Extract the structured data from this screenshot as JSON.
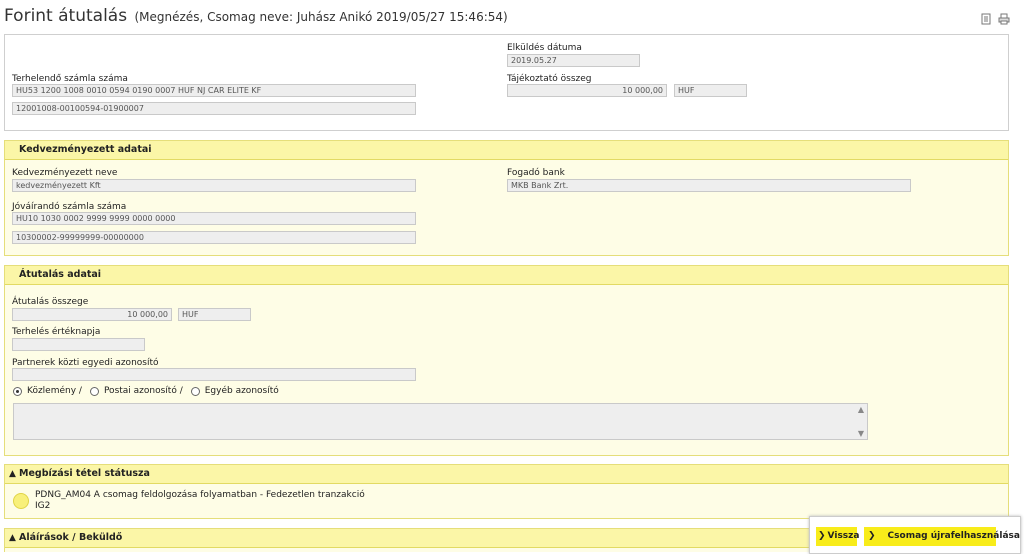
{
  "header": {
    "title": "Forint átutalás",
    "subtitle": "(Megnézés, Csomag neve: Juhász Anikó 2019/05/27 15:46:54)"
  },
  "general": {
    "send_date_label": "Elküldés dátuma",
    "send_date_value": "2019.05.27",
    "debit_account_label": "Terhelendő számla száma",
    "debit_account_iban": "HU53 1200 1008 0010 0594 0190 0007 HUF NJ CAR ELITE KF",
    "debit_account_bban": "12001008-00100594-01900007",
    "info_amount_label": "Tájékoztató összeg",
    "info_amount_value": "10 000,00",
    "info_amount_currency": "HUF"
  },
  "beneficiary": {
    "section_title": "Kedvezményezett adatai",
    "name_label": "Kedvezményezett neve",
    "name_value": "kedvezményezett Kft",
    "bank_label": "Fogadó bank",
    "bank_value": "MKB Bank Zrt.",
    "account_label": "Jóváírandó számla száma",
    "account_iban": "HU10 1030 0002 9999 9999 0000 0000",
    "account_bban": "10300002-99999999-00000000"
  },
  "transfer": {
    "section_title": "Átutalás adatai",
    "amount_label": "Átutalás összege",
    "amount_value": "10 000,00",
    "amount_currency": "HUF",
    "value_date_label": "Terhelés értéknapja",
    "value_date_value": "",
    "partner_id_label": "Partnerek közti egyedi azonosító",
    "partner_id_value": "",
    "radio_options": [
      "Közlemény /",
      "Postai azonosító /",
      "Egyéb azonosító"
    ],
    "radio_selected_index": 0,
    "memo_value": ""
  },
  "status": {
    "section_title": "Megbízási tétel státusza",
    "line1": "PDNG_AM04 A csomag feldolgozása folyamatban - Fedezetlen tranzakció",
    "line2": "IG2",
    "indicator_color": "#f8f07a"
  },
  "signatures": {
    "section_title": "Aláírások / Beküldő"
  },
  "buttons": {
    "back": "Vissza",
    "reuse": "Csomag újrafelhasználása"
  },
  "icons": {
    "doc": "document-icon",
    "print": "printer-icon",
    "collapse": "caret-up-icon"
  },
  "colors": {
    "section_header": "#fbf6a7",
    "section_body": "#fefde6",
    "button": "#f8ec1a"
  }
}
